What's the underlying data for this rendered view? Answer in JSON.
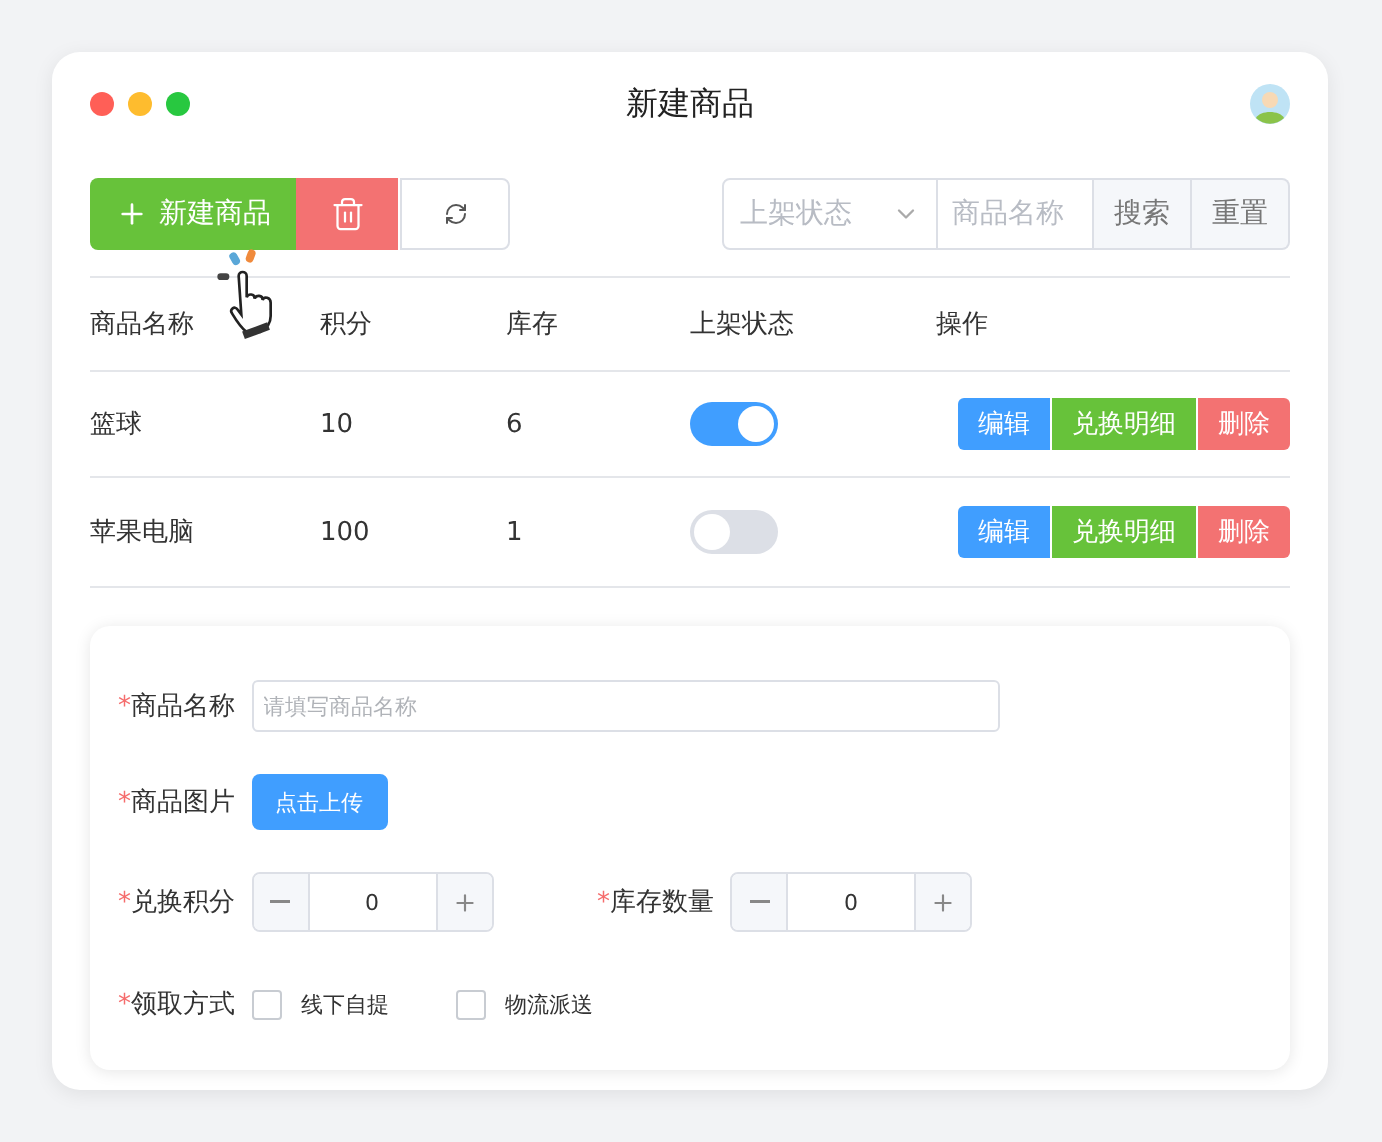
{
  "window": {
    "title": "新建商品"
  },
  "toolbar": {
    "new_button": "新建商品",
    "status_select": {
      "placeholder": "上架状态"
    },
    "name_search": {
      "placeholder": "商品名称"
    },
    "search_button": "搜索",
    "reset_button": "重置"
  },
  "table": {
    "columns": [
      "商品名称",
      "积分",
      "库存",
      "上架状态",
      "操作"
    ],
    "rows": [
      {
        "name": "篮球",
        "points": "10",
        "stock": "6",
        "on": true,
        "actions": [
          {
            "label": "编辑",
            "kind": "primary"
          },
          {
            "label": "兑换明细",
            "kind": "success"
          },
          {
            "label": "删除",
            "kind": "danger"
          }
        ]
      },
      {
        "name": "苹果电脑",
        "points": "100",
        "stock": "1",
        "on": false,
        "actions": [
          {
            "label": "编辑",
            "kind": "primary"
          },
          {
            "label": "兑换明细",
            "kind": "success"
          },
          {
            "label": "删除",
            "kind": "danger"
          }
        ]
      }
    ]
  },
  "form": {
    "fields": [
      {
        "kind": "text",
        "required_mark": "*",
        "label": "商品名称",
        "placeholder": "请填写商品名称"
      },
      {
        "kind": "upload",
        "required_mark": "*",
        "label": "商品图片",
        "button": "点击上传"
      },
      {
        "kind": "numbers",
        "items": [
          {
            "required_mark": "*",
            "label": "兑换积分",
            "value": "0"
          },
          {
            "required_mark": "*",
            "label": "库存数量",
            "value": "0"
          }
        ]
      },
      {
        "kind": "checkboxes",
        "required_mark": "*",
        "label": "领取方式",
        "options": [
          {
            "label": "线下自提",
            "checked": false
          },
          {
            "label": "物流派送",
            "checked": false
          }
        ]
      }
    ]
  }
}
